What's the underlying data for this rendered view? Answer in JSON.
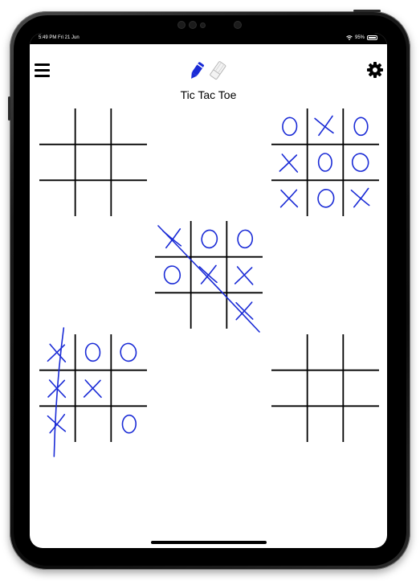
{
  "status_bar": {
    "time": "5:49 PM  Fri 21 Jun",
    "battery": "95%"
  },
  "app": {
    "title": "Tic Tac Toe"
  },
  "toolbar": {
    "menu_icon": "hamburger-menu-icon",
    "pen_icon": "pencil-icon",
    "eraser_icon": "eraser-icon",
    "settings_icon": "gear-icon",
    "pen_color": "#1a2bd6"
  },
  "ink_color": "#1a2bd6",
  "boards": [
    {
      "id": "top-left",
      "cells": [
        "",
        "",
        "",
        "",
        "",
        "",
        "",
        "",
        ""
      ],
      "strike": null
    },
    {
      "id": "top-right",
      "cells": [
        "O",
        "X",
        "O",
        "X",
        "O",
        "O",
        "X",
        "O",
        "X"
      ],
      "strike": null
    },
    {
      "id": "center",
      "cells": [
        "X",
        "O",
        "O",
        "O",
        "X",
        "X",
        "",
        "",
        "X"
      ],
      "strike": "diagonal"
    },
    {
      "id": "bottom-left",
      "cells": [
        "X",
        "O",
        "O",
        "X",
        "X",
        "",
        "X",
        "",
        "O"
      ],
      "strike": "left-column"
    },
    {
      "id": "bottom-right",
      "cells": [
        "",
        "",
        "",
        "",
        "",
        "",
        "",
        "",
        ""
      ],
      "strike": null
    }
  ]
}
